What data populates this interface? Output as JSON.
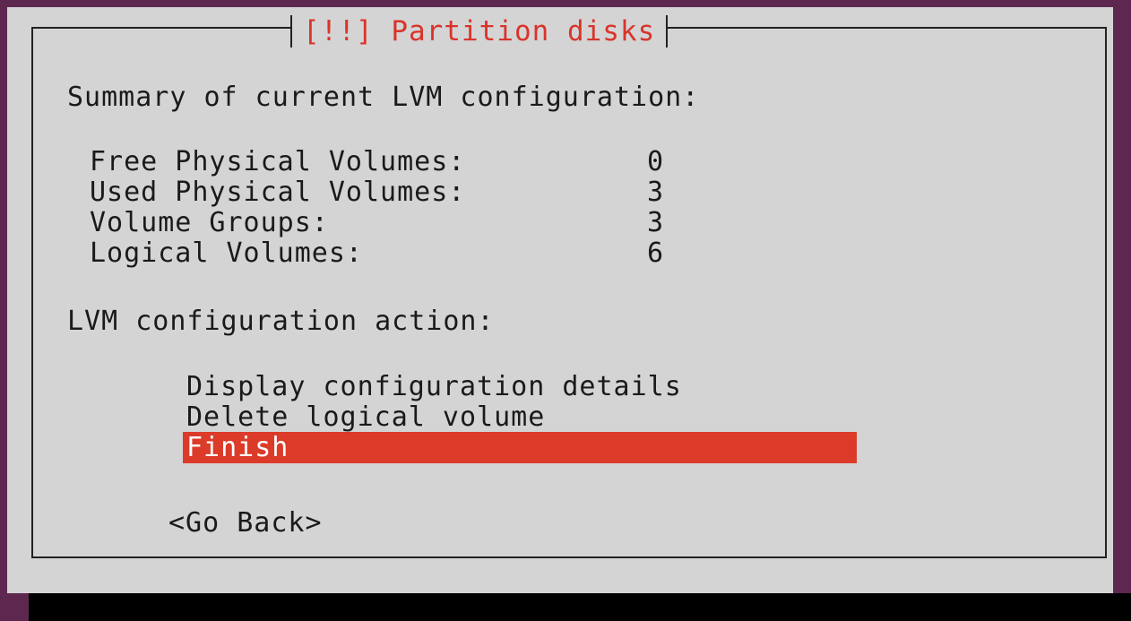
{
  "dialog": {
    "title": "[!!] Partition disks",
    "summary_heading": "Summary of current LVM configuration:",
    "stats": [
      {
        "label": "Free Physical Volumes:",
        "value": "0"
      },
      {
        "label": "Used Physical Volumes:",
        "value": "3"
      },
      {
        "label": "Volume Groups:",
        "value": "3"
      },
      {
        "label": "Logical Volumes:",
        "value": "6"
      }
    ],
    "action_heading": "LVM configuration action:",
    "menu": [
      {
        "label": "Display configuration details",
        "selected": false
      },
      {
        "label": "Delete logical volume",
        "selected": false
      },
      {
        "label": "Finish",
        "selected": true
      }
    ],
    "go_back_label": "<Go Back>"
  },
  "colors": {
    "desktop": "#5e2750",
    "dialog_bg": "#d4d4d4",
    "title_text": "#d9342b",
    "selection": "#dc3b2a"
  }
}
